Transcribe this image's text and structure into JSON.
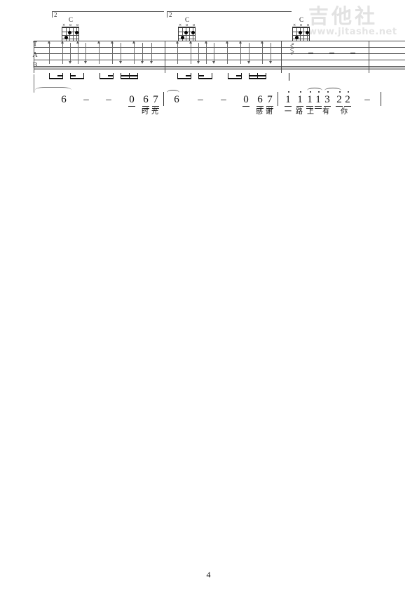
{
  "document": {
    "type": "guitar-tablature",
    "page_number": "4"
  },
  "watermark": {
    "chinese": "吉他社",
    "url": "www.jitashe.net"
  },
  "staff": {
    "clef_letters": [
      "T",
      "A",
      "B"
    ],
    "clef_label": "TAB"
  },
  "voltas": [
    {
      "number": "2"
    },
    {
      "number": "2"
    }
  ],
  "chords": [
    {
      "name": "C",
      "open_strings": [
        "o",
        "o"
      ],
      "fingering": "x32010"
    },
    {
      "name": "C",
      "open_strings": [
        "o",
        "o"
      ],
      "fingering": "x32010"
    },
    {
      "name": "C",
      "open_strings": [
        "o",
        "o"
      ],
      "fingering": "x32010"
    }
  ],
  "measures": [
    {
      "index": 1,
      "chord": "C",
      "notes": [
        "6",
        "–",
        "–",
        "0",
        "6",
        "7"
      ],
      "lyrics": [
        "时",
        "光"
      ]
    },
    {
      "index": 2,
      "chord": "C",
      "notes": [
        "6",
        "–",
        "–",
        "0",
        "6",
        "7"
      ],
      "lyrics": [
        "感",
        "谢"
      ]
    },
    {
      "index": 3,
      "chord": "C",
      "notes": [
        "1",
        "1",
        "1",
        "1",
        "3",
        "2",
        "2",
        "–"
      ],
      "lyrics": [
        "一",
        "路",
        "上",
        "有",
        "你"
      ]
    }
  ],
  "notation_row": {
    "m1": {
      "n1": "6",
      "n2": "–",
      "n3": "–",
      "n4": "0",
      "n5": "6",
      "n6": "7",
      "lyric1": "时",
      "lyric2": "光"
    },
    "m2": {
      "n1": "6",
      "n2": "–",
      "n3": "–",
      "n4": "0",
      "n5": "6",
      "n6": "7",
      "lyric1": "感",
      "lyric2": "谢"
    },
    "m3": {
      "n1": "1",
      "n2": "1",
      "n3": "1",
      "n4": "1",
      "n5": "3",
      "n6": "2",
      "n7": "2",
      "n8": "–",
      "lyric1": "一",
      "lyric2": "路",
      "lyric3": "上",
      "lyric4": "有",
      "lyric5": "你"
    }
  },
  "tab_measure_3": {
    "rest_dashes": [
      "–",
      "–",
      "–"
    ]
  },
  "colors": {
    "ink": "#111111",
    "staff_line": "#4a4a4a",
    "staff_band": "#c8c8c8",
    "watermark": "#e2e2e2"
  }
}
